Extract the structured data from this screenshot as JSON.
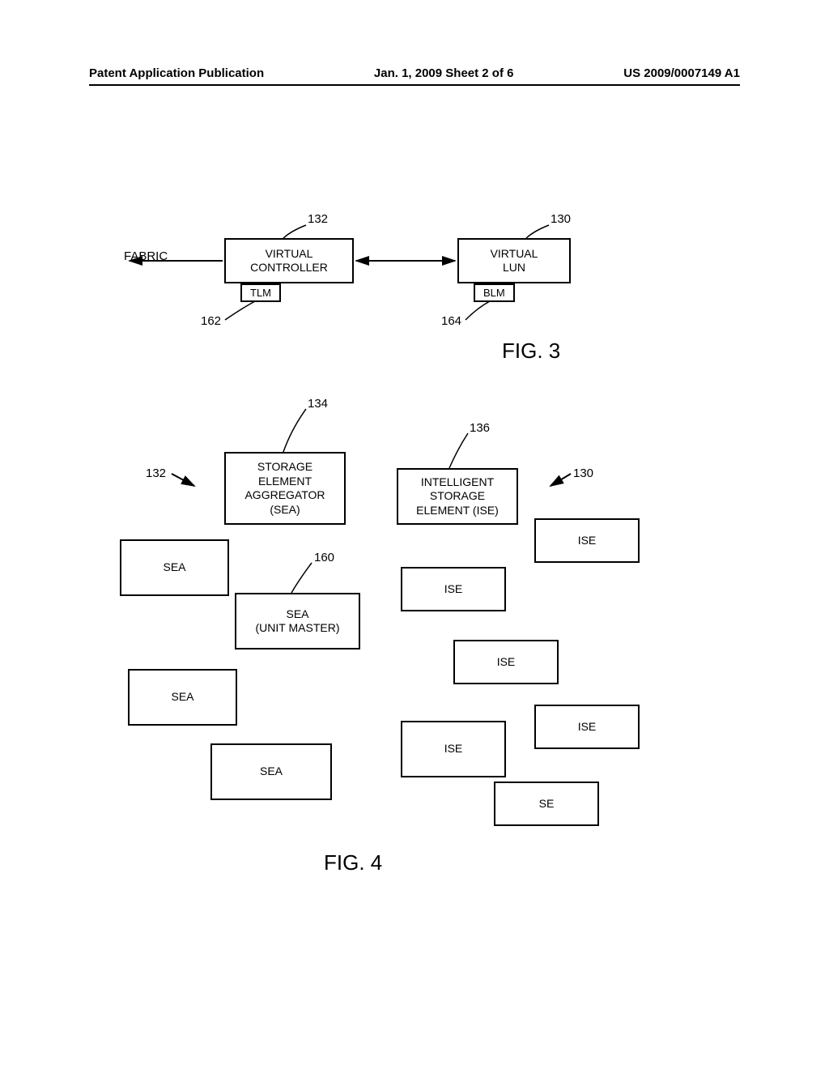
{
  "header": {
    "left": "Patent Application Publication",
    "center": "Jan. 1, 2009   Sheet 2 of 6",
    "right": "US 2009/0007149 A1"
  },
  "fig3": {
    "fabric": "FABRIC",
    "vc_box": "VIRTUAL\nCONTROLLER",
    "vc_sub": "TLM",
    "vl_box": "VIRTUAL\nLUN",
    "vl_sub": "BLM",
    "ref_132": "132",
    "ref_130": "130",
    "ref_162": "162",
    "ref_164": "164",
    "caption": "FIG. 3"
  },
  "fig4": {
    "sea_main": "STORAGE\nELEMENT\nAGGREGATOR\n(SEA)",
    "ise_main": "INTELLIGENT\nSTORAGE\nELEMENT (ISE)",
    "sea": "SEA",
    "sea_master": "SEA\n(UNIT MASTER)",
    "ise": "ISE",
    "se": "SE",
    "ref_134": "134",
    "ref_136": "136",
    "ref_132": "132",
    "ref_130": "130",
    "ref_160": "160",
    "caption": "FIG. 4"
  }
}
